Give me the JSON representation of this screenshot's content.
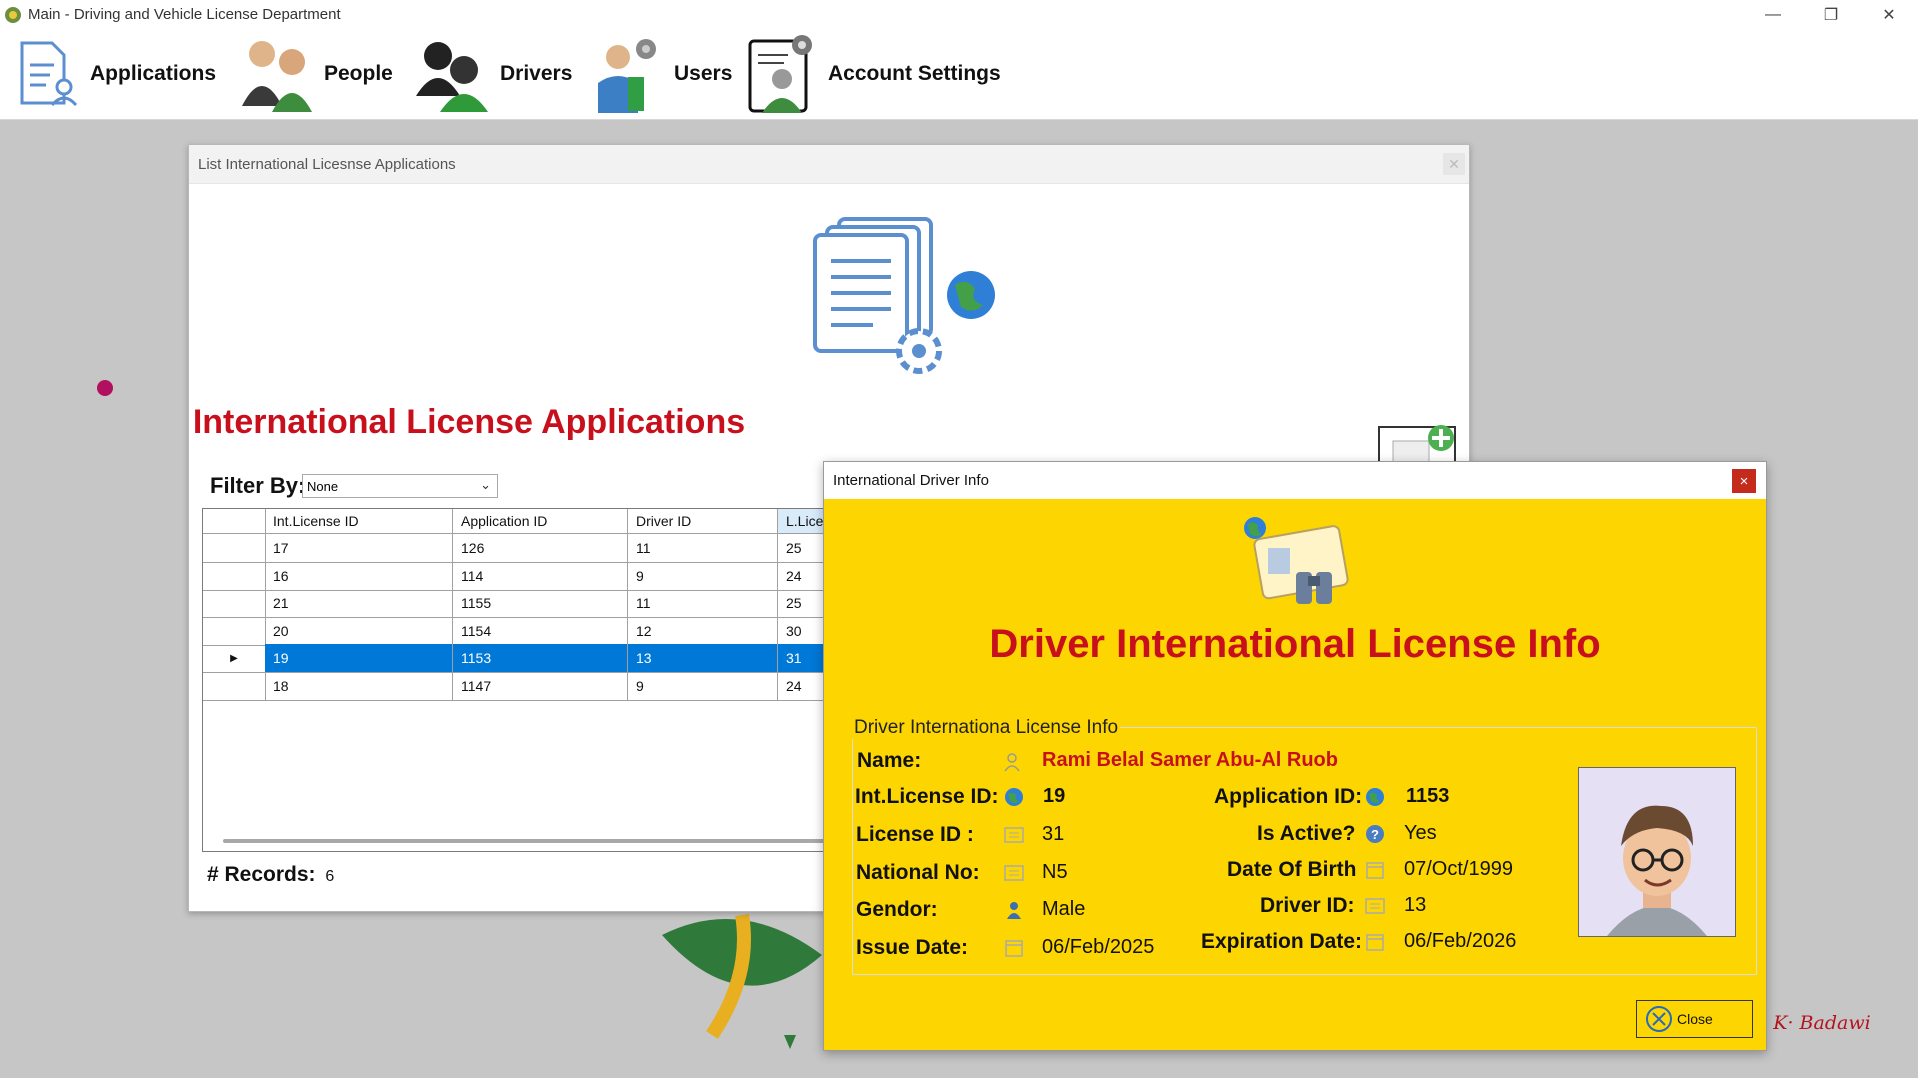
{
  "window": {
    "title": "Main - Driving and Vehicle License Department",
    "minimize": "—",
    "restore": "❐",
    "close": "✕"
  },
  "menu": [
    {
      "label": "Applications",
      "icon": "applications-icon"
    },
    {
      "label": "People",
      "icon": "people-icon"
    },
    {
      "label": "Drivers",
      "icon": "drivers-icon"
    },
    {
      "label": "Users",
      "icon": "users-icon"
    },
    {
      "label": "Account Settings",
      "icon": "account-settings-icon"
    }
  ],
  "list_window": {
    "title": "List International Licesnse Applications",
    "heading": "International License Applications",
    "filter_label": "Filter By:",
    "filter_value": "None",
    "columns": [
      "Int.License ID",
      "Application ID",
      "Driver ID",
      "L.Lice"
    ],
    "rows": [
      [
        "17",
        "126",
        "11",
        "25"
      ],
      [
        "16",
        "114",
        "9",
        "24"
      ],
      [
        "21",
        "1155",
        "11",
        "25"
      ],
      [
        "20",
        "1154",
        "12",
        "30"
      ],
      [
        "19",
        "1153",
        "13",
        "31"
      ],
      [
        "18",
        "1147",
        "9",
        "24"
      ]
    ],
    "selected_row": 4,
    "records_label": "# Records:",
    "records_count": "6"
  },
  "dialog": {
    "title": "International Driver Info",
    "close_x": "×",
    "heading": "Driver International License Info",
    "group_title": "Driver Internationa License Info",
    "labels": {
      "name": "Name:",
      "int_license_id": "Int.License ID:",
      "license_id": "License ID :",
      "national_no": "National No:",
      "gender": "Gendor:",
      "issue_date": "Issue Date:",
      "application_id": "Application ID:",
      "is_active": "Is Active?",
      "date_of_birth": "Date Of Birth",
      "driver_id": "Driver ID:",
      "expiration_date": "Expiration Date:"
    },
    "values": {
      "name": "Rami Belal Samer Abu-Al Ruob",
      "int_license_id": "19",
      "license_id": "31",
      "national_no": "N5",
      "gender": "Male",
      "issue_date": "06/Feb/2025",
      "application_id": "1153",
      "is_active": "Yes",
      "date_of_birth": "07/Oct/1999",
      "driver_id": "13",
      "expiration_date": "06/Feb/2026"
    },
    "close_button": "Close"
  },
  "signature": "h K· Badawi",
  "colors": {
    "accent_red": "#c8101d",
    "dialog_bg": "#fdd602",
    "selection": "#0078d7"
  }
}
